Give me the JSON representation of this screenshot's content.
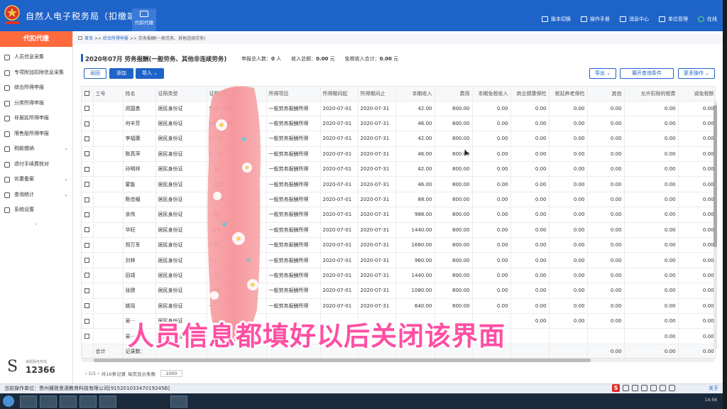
{
  "app": {
    "title": "自然人电子税务局（扣缴端）",
    "module_tab": "代扣代缴"
  },
  "top_menu": [
    {
      "label": "版本切换",
      "icon": "switch-icon"
    },
    {
      "label": "操作手册",
      "icon": "book-icon"
    },
    {
      "label": "消息中心",
      "icon": "message-icon"
    },
    {
      "label": "单位管理",
      "icon": "building-icon"
    },
    {
      "label": "在线",
      "icon": "online-icon"
    }
  ],
  "sidebar": {
    "header": "代扣代缴",
    "items": [
      {
        "label": "人员信息采集",
        "icon": "person-icon",
        "has_caret": false
      },
      {
        "label": "专项附加扣除信息采集",
        "icon": "doc-icon",
        "has_caret": false
      },
      {
        "label": "综合所得申报",
        "icon": "layers-icon",
        "has_caret": false
      },
      {
        "label": "分类所得申报",
        "icon": "layers-icon",
        "has_caret": false
      },
      {
        "label": "非居民所得申报",
        "icon": "user-icon",
        "has_caret": false
      },
      {
        "label": "限售股所得申报",
        "icon": "chart-icon",
        "has_caret": false
      },
      {
        "label": "税款缴纳",
        "icon": "coin-icon",
        "has_caret": true
      },
      {
        "label": "退付手续费核对",
        "icon": "refund-icon",
        "has_caret": false
      },
      {
        "label": "优惠备案",
        "icon": "gift-icon",
        "has_caret": true
      },
      {
        "label": "查询统计",
        "icon": "search-icon",
        "has_caret": true
      },
      {
        "label": "系统设置",
        "icon": "gear-icon",
        "has_caret": false
      }
    ],
    "collapse_glyph": "‹",
    "hotline_caption": "纳税服务热线",
    "hotline_number": "12366"
  },
  "breadcrumb": {
    "home": "首页",
    "sep": ">>",
    "level1": "综合所得申报",
    "level2": "劳务报酬(一般劳务、其他连续劳务)"
  },
  "page": {
    "title": "2020年07月  劳务报酬(一般劳务、其他非连续劳务)",
    "summary": [
      {
        "label": "申报总人数：",
        "value": "0",
        "unit": "人"
      },
      {
        "label": "收入总额：",
        "value": "0.00",
        "unit": "元"
      },
      {
        "label": "免税收入合计：",
        "value": "0.00",
        "unit": "元"
      }
    ]
  },
  "toolbar": {
    "back": "返回",
    "add": "添加",
    "import": "导入 ⌄",
    "export": "导出 ⌄",
    "expand_query": "展开查询条件",
    "more": "更多操作 ⌄"
  },
  "table": {
    "columns": [
      "",
      "工号",
      "姓名",
      "证照类型",
      "证照号码",
      "所得项目",
      "所得期间起",
      "所得期间止",
      "本期收入",
      "费用",
      "本期免税收入",
      "商业健康保险",
      "税延养老保险",
      "其他",
      "允许扣除的税费",
      "减免税额"
    ],
    "rows": [
      [
        "",
        "闵国勇",
        "居民身份证",
        "522···112",
        "一般劳务报酬所得",
        "2020-07-01",
        "2020-07-31",
        "42.00",
        "800.00",
        "0.00",
        "0.00",
        "0.00",
        "0.00",
        "0.00",
        "0.00"
      ],
      [
        "",
        "何丰芳",
        "居民身份证",
        "522···520",
        "一般劳务报酬所得",
        "2020-07-01",
        "2020-07-31",
        "46.00",
        "800.00",
        "0.00",
        "0.00",
        "0.00",
        "0.00",
        "0.00",
        "0.00"
      ],
      [
        "",
        "李福康",
        "居民身份证",
        "5···39",
        "一般劳务报酬所得",
        "2020-07-01",
        "2020-07-31",
        "42.00",
        "800.00",
        "0.00",
        "0.00",
        "0.00",
        "0.00",
        "0.00",
        "0.00"
      ],
      [
        "",
        "陈高萍",
        "居民身份证",
        "5···52",
        "一般劳务报酬所得",
        "2020-07-01",
        "2020-07-31",
        "46.00",
        "800.00",
        "0.00",
        "0.00",
        "0.00",
        "0.00",
        "0.00",
        "0.00"
      ],
      [
        "",
        "孙明祥",
        "居民身份证",
        "···16",
        "一般劳务报酬所得",
        "2020-07-01",
        "2020-07-31",
        "42.00",
        "800.00",
        "0.00",
        "0.00",
        "0.00",
        "0.00",
        "0.00",
        "0.00"
      ],
      [
        "",
        "蒙能",
        "居民身份证",
        "···321",
        "一般劳务报酬所得",
        "2020-07-01",
        "2020-07-31",
        "46.00",
        "800.00",
        "0.00",
        "0.00",
        "0.00",
        "0.00",
        "0.00",
        "0.00"
      ],
      [
        "",
        "陈佳楣",
        "居民身份证",
        "···210",
        "一般劳务报酬所得",
        "2020-07-01",
        "2020-07-31",
        "88.00",
        "800.00",
        "0.00",
        "0.00",
        "0.00",
        "0.00",
        "0.00",
        "0.00"
      ],
      [
        "",
        "余伟",
        "居民身份证",
        "···54",
        "一般劳务报酬所得",
        "2020-07-01",
        "2020-07-31",
        "988.00",
        "800.00",
        "0.00",
        "0.00",
        "0.00",
        "0.00",
        "0.00",
        "0.00"
      ],
      [
        "",
        "华旺",
        "居民身份证",
        "···26",
        "一般劳务报酬所得",
        "2020-07-01",
        "2020-07-31",
        "1440.00",
        "800.00",
        "0.00",
        "0.00",
        "0.00",
        "0.00",
        "0.00",
        "0.00"
      ],
      [
        "",
        "郑万军",
        "居民身份证",
        "···91",
        "一般劳务报酬所得",
        "2020-07-01",
        "2020-07-31",
        "1680.00",
        "800.00",
        "0.00",
        "0.00",
        "0.00",
        "0.00",
        "0.00",
        "0.00"
      ],
      [
        "",
        "刘林",
        "居民身份证",
        "···X",
        "一般劳务报酬所得",
        "2020-07-01",
        "2020-07-31",
        "960.00",
        "800.00",
        "0.00",
        "0.00",
        "0.00",
        "0.00",
        "0.00",
        "0.00"
      ],
      [
        "",
        "田靖",
        "居民身份证",
        "···35",
        "一般劳务报酬所得",
        "2020-07-01",
        "2020-07-31",
        "1440.00",
        "800.00",
        "0.00",
        "0.00",
        "0.00",
        "0.00",
        "0.00",
        "0.00"
      ],
      [
        "",
        "张健",
        "居民身份证",
        "···36",
        "一般劳务报酬所得",
        "2020-07-01",
        "2020-07-31",
        "1080.00",
        "800.00",
        "0.00",
        "0.00",
        "0.00",
        "0.00",
        "0.00",
        "0.00"
      ],
      [
        "",
        "姚瑶",
        "居民身份证",
        "···",
        "一般劳务报酬所得",
        "2020-07-01",
        "2020-07-31",
        "640.00",
        "800.00",
        "0.00",
        "0.00",
        "0.00",
        "0.00",
        "0.00",
        "0.00"
      ],
      [
        "",
        "吴···",
        "居民身份证",
        "",
        "",
        "",
        "",
        "",
        "",
        "",
        "0.00",
        "0.00",
        "0.00",
        "0.00",
        "0.00"
      ],
      [
        "",
        "易···",
        "居民身份证",
        "",
        "",
        "",
        "",
        "",
        "",
        "",
        "",
        "",
        "",
        "0.00",
        "0.00"
      ]
    ],
    "total_row": [
      "合计",
      "记录数：",
      "",
      "",
      "",
      "",
      "",
      "",
      "",
      "",
      "",
      "",
      "0.00",
      "0.00",
      "0.00"
    ]
  },
  "pager": {
    "nav": "‹ 1/1 ›",
    "total": "共16条记录",
    "per_page_label": "每页显示条数",
    "per_page": "1000"
  },
  "statusbar": {
    "operator": "当前操作单位：贵州雅致思语教育科技有限公司[91520103347019245B]",
    "about": "关于"
  },
  "overlay": {
    "caption": "人员信息都填好以后关闭该界面"
  },
  "taskbar": {
    "time": "14:56"
  },
  "colors": {
    "brand": "#1e63c8",
    "sidebar_header": "#ff6a3d",
    "caption": "#ff4fa3"
  }
}
